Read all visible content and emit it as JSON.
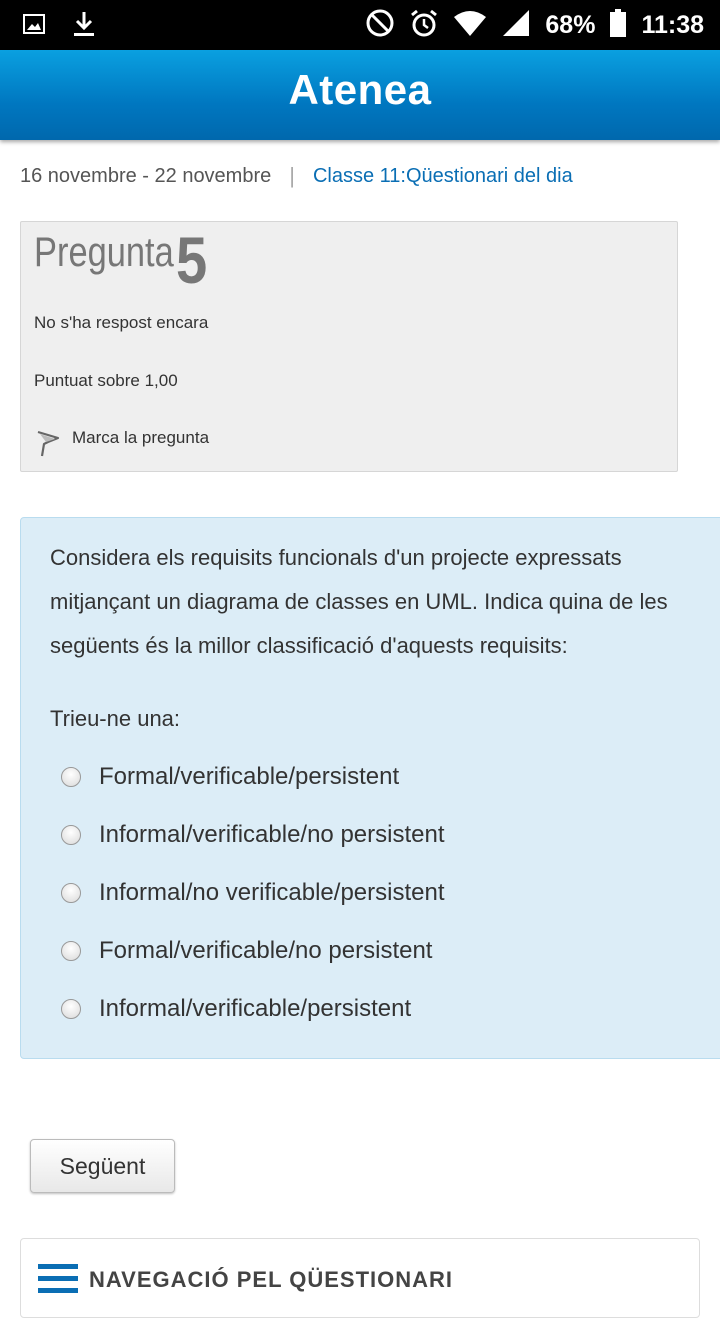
{
  "status_bar": {
    "battery": "68%",
    "time": "11:38",
    "icons": [
      "image-icon",
      "download-icon",
      "do-not-disturb-icon",
      "alarm-icon",
      "wifi-icon",
      "signal-icon",
      "battery-icon"
    ]
  },
  "app": {
    "title": "Atenea"
  },
  "breadcrumb": {
    "date_range": "16 novembre - 22 novembre",
    "separator": "|",
    "current": "Classe 11:Qüestionari del dia"
  },
  "question_info": {
    "label": "Pregunta",
    "number": "5",
    "status": "No s'ha respost encara",
    "grade": "Puntuat sobre 1,00",
    "flag_label": "Marca la pregunta"
  },
  "question": {
    "text": "Considera els requisits funcionals d'un projecte expressats mitjançant un diagrama de classes en UML. Indica quina de les següents és la millor classificació d'aquests requisits:",
    "prompt": "Trieu-ne una:",
    "options": [
      "Formal/verificable/persistent",
      "Informal/verificable/no persistent",
      "Informal/no verificable/persistent",
      "Formal/verificable/no persistent",
      "Informal/verificable/persistent"
    ]
  },
  "buttons": {
    "next": "Següent"
  },
  "navigation": {
    "title": "NAVEGACIÓ PEL QÜESTIONARI"
  },
  "colors": {
    "appbar": "#0077c0",
    "link": "#0a6eb4",
    "question_bg": "#dcedf7",
    "info_bg": "#efefef"
  }
}
